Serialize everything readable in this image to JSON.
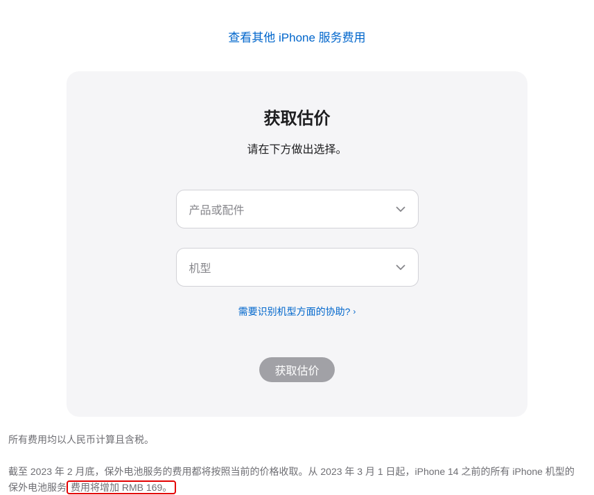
{
  "topLink": "查看其他 iPhone 服务费用",
  "card": {
    "title": "获取估价",
    "subtitle": "请在下方做出选择。",
    "select1Placeholder": "产品或配件",
    "select2Placeholder": "机型",
    "helpLink": "需要识别机型方面的协助?",
    "submitBtn": "获取估价"
  },
  "footer": {
    "line1": "所有费用均以人民币计算且含税。",
    "line2a": "截至 2023 年 2 月底，保外电池服务的费用都将按照当前的价格收取。从 2023 年 3 月 1 日起，iPhone 14 之前的所有 iPhone 机型的保外电池服务",
    "line2b": "费用将增加 RMB 169。"
  }
}
